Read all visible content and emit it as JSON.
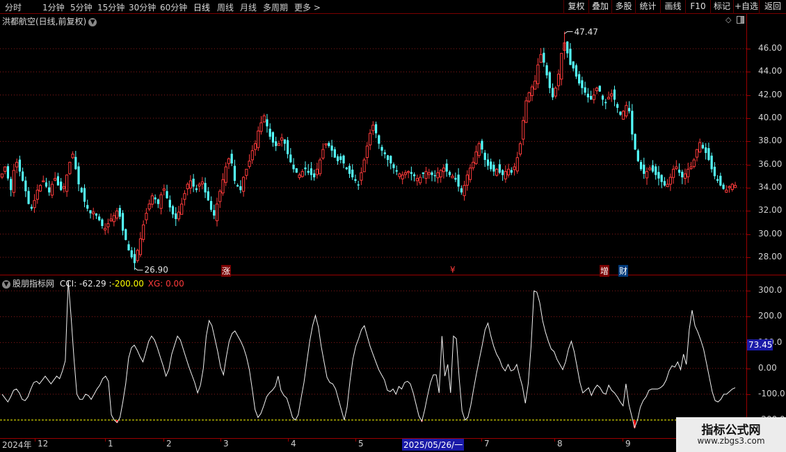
{
  "toolbar": {
    "timeframes": [
      "分时",
      "1分钟",
      "5分钟",
      "15分钟",
      "30分钟",
      "60分钟",
      "日线",
      "周线",
      "月线",
      "多周期",
      "更多"
    ],
    "right_buttons": [
      "复权",
      "叠加",
      "多股",
      "统计",
      "画线",
      "F10",
      "标记",
      "+自选",
      "返回"
    ]
  },
  "title": {
    "stock": "洪都航空(日线,前复权)"
  },
  "price_axis": [
    "46.00",
    "44.00",
    "42.00",
    "40.00",
    "38.00",
    "36.00",
    "34.00",
    "32.00",
    "30.00",
    "28.00"
  ],
  "price_annotations": {
    "high": "47.47",
    "low": "26.90"
  },
  "event_markers": [
    "涨",
    "¥",
    "增",
    "财"
  ],
  "indicator": {
    "name": "股朋指标网",
    "cci_text": "CCI: -62.29",
    "sep": ":",
    "level_text": "-200.00",
    "xg_text": "XG: 0.00",
    "axis": [
      "300.0",
      "200.0",
      "100.0",
      "0.00",
      "-100.0",
      "-200.0"
    ],
    "current_value": "73.45"
  },
  "date_axis": {
    "labels": [
      "2024年",
      "12",
      "1",
      "2",
      "3",
      "4",
      "5",
      "2025/05/26/一",
      "7",
      "8",
      "9"
    ]
  },
  "watermark": {
    "title": "指标公式网",
    "url": "www.zbgs3.com"
  },
  "colors": {
    "up": "#ff3b3b",
    "down": "#54ffff",
    "grid": "#8a1a1a",
    "border": "#9a0000",
    "level": "#ffff00",
    "alert": "#ff0000"
  },
  "chart_data": [
    {
      "type": "candlestick",
      "ylim": [
        26.5,
        47.8
      ],
      "series": [
        {
          "values": [
            35.2,
            35.8,
            34.8,
            33.8,
            35.5,
            36.2,
            35.4,
            34.6,
            33.7,
            32.6,
            32.2,
            32.9,
            33.8,
            34.2,
            34.6,
            34.1,
            33.6,
            34.3,
            34.8,
            34.2,
            33.8,
            34.1,
            35.1,
            36.2,
            36.9,
            35.6,
            34.3,
            33.6,
            32.8,
            32.2,
            31.8,
            31.9,
            31.6,
            31.2,
            30.7,
            30.5,
            30.9,
            31.3,
            31.6,
            32.0,
            31.5,
            30.3,
            29.5,
            28.6,
            28.0,
            27.5,
            28.6,
            29.6,
            30.8,
            31.8,
            32.6,
            33.3,
            33.0,
            32.6,
            33.4,
            33.9,
            33.1,
            32.3,
            31.7,
            31.3,
            31.9,
            32.6,
            33.5,
            34.3,
            34.6,
            34.1,
            33.8,
            34.3,
            34.5,
            33.6,
            32.9,
            32.1,
            31.6,
            32.6,
            33.7,
            34.7,
            35.8,
            36.5,
            36.1,
            34.6,
            34.1,
            33.8,
            34.9,
            35.6,
            36.3,
            37.2,
            37.8,
            38.9,
            39.6,
            40.2,
            39.3,
            38.4,
            37.9,
            37.6,
            37.8,
            38.3,
            37.8,
            36.9,
            36.2,
            35.6,
            35.3,
            35.1,
            35.4,
            35.6,
            35.3,
            35.1,
            34.9,
            35.6,
            36.4,
            37.3,
            37.8,
            37.6,
            37.2,
            36.6,
            36.3,
            36.4,
            36.1,
            35.6,
            35.2,
            34.9,
            34.6,
            34.2,
            35.3,
            36.4,
            37.6,
            38.7,
            39.4,
            38.7,
            37.8,
            37.2,
            36.9,
            36.4,
            36.1,
            35.7,
            35.4,
            35.2,
            35.1,
            35.3,
            35.4,
            35.2,
            35.0,
            34.8,
            34.9,
            35.2,
            35.4,
            35.3,
            35.1,
            35.0,
            35.3,
            35.5,
            35.7,
            35.4,
            35.1,
            35.0,
            34.7,
            34.1,
            33.6,
            34.2,
            35.1,
            35.7,
            36.2,
            37.1,
            37.8,
            37.3,
            36.4,
            35.9,
            35.6,
            35.4,
            35.6,
            35.3,
            35.1,
            35.4,
            35.6,
            35.3,
            35.8,
            36.6,
            37.8,
            39.8,
            41.5,
            42.2,
            42.7,
            43.2,
            44.6,
            45.5,
            44.8,
            43.7,
            42.6,
            41.8,
            42.6,
            43.8,
            45.6,
            46.5,
            45.6,
            44.6,
            44.3,
            43.6,
            43.0,
            42.6,
            42.2,
            41.8,
            41.6,
            42.0,
            42.6,
            42.3,
            41.6,
            41.3,
            41.8,
            42.1,
            41.6,
            40.9,
            40.3,
            40.6,
            41.1,
            40.6,
            38.6,
            37.3,
            36.3,
            35.6,
            35.2,
            35.4,
            35.7,
            35.4,
            35.1,
            34.8,
            34.5,
            34.2,
            34.3,
            34.9,
            35.6,
            35.8,
            35.3,
            34.9,
            35.2,
            35.6,
            35.8,
            36.4,
            37.3,
            37.9,
            37.4,
            37.0,
            36.4,
            35.6,
            35.0,
            34.6,
            34.2,
            33.9,
            33.8,
            34.1,
            34.3,
            34.2
          ]
        }
      ]
    },
    {
      "type": "line",
      "ylim": [
        -270,
        360
      ],
      "series": [
        {
          "name": "CCI",
          "values": [
            -100,
            -115,
            -130,
            -110,
            -85,
            -80,
            -95,
            -120,
            -125,
            -110,
            -80,
            -55,
            -50,
            -60,
            -45,
            -30,
            -45,
            -60,
            -45,
            -30,
            -40,
            -10,
            30,
            340,
            200,
            40,
            -100,
            -120,
            -120,
            -100,
            -105,
            -120,
            -100,
            -80,
            -65,
            -40,
            -30,
            -50,
            -180,
            -200,
            -210,
            -190,
            -130,
            -60,
            40,
            80,
            90,
            70,
            45,
            25,
            65,
            105,
            125,
            110,
            80,
            45,
            10,
            -30,
            -5,
            55,
            90,
            125,
            110,
            75,
            40,
            5,
            -25,
            -55,
            -95,
            -65,
            0,
            125,
            185,
            165,
            115,
            65,
            5,
            -25,
            45,
            105,
            135,
            145,
            125,
            105,
            80,
            45,
            -5,
            -80,
            -160,
            -190,
            -175,
            -145,
            -110,
            -95,
            -85,
            -70,
            -30,
            -85,
            -105,
            -115,
            -150,
            -190,
            -200,
            -180,
            -115,
            -55,
            25,
            105,
            165,
            205,
            160,
            85,
            25,
            -35,
            -55,
            -60,
            -80,
            -120,
            -160,
            -200,
            -150,
            -50,
            35,
            85,
            115,
            150,
            165,
            125,
            85,
            55,
            25,
            -5,
            -25,
            -45,
            -85,
            -90,
            -80,
            -100,
            -70,
            -80,
            -55,
            -50,
            -60,
            -95,
            -140,
            -185,
            -205,
            -160,
            -105,
            -55,
            -25,
            -25,
            -95,
            125,
            -30,
            15,
            -95,
            125,
            115,
            -40,
            -165,
            -200,
            -190,
            -145,
            -80,
            -20,
            35,
            90,
            150,
            175,
            125,
            85,
            55,
            35,
            5,
            -10,
            15,
            -10,
            -5,
            15,
            -30,
            -70,
            -135,
            -60,
            85,
            300,
            295,
            255,
            185,
            140,
            105,
            75,
            65,
            35,
            15,
            -5,
            25,
            75,
            105,
            65,
            5,
            -55,
            -95,
            -85,
            -75,
            -105,
            -80,
            -65,
            -75,
            -95,
            -100,
            -65,
            -85,
            -95,
            -110,
            -130,
            -145,
            -60,
            -140,
            -185,
            -230,
            -200,
            -150,
            -125,
            -110,
            -85,
            -80,
            -80,
            -80,
            -75,
            -65,
            -45,
            -10,
            10,
            5,
            25,
            -5,
            55,
            15,
            150,
            225,
            165,
            140,
            110,
            75,
            20,
            -35,
            -90,
            -125,
            -130,
            -120,
            -100,
            -100,
            -90,
            -80,
            -75
          ]
        }
      ]
    }
  ]
}
